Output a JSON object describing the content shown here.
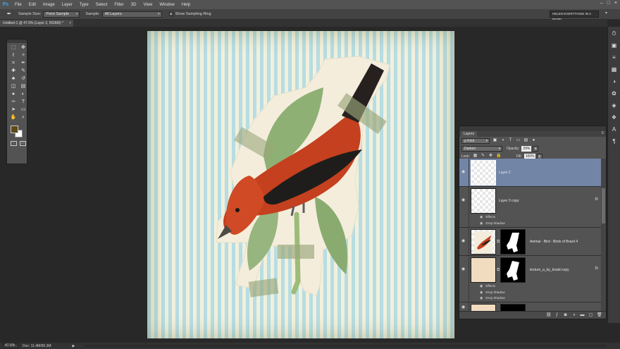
{
  "menubar": {
    "logo": "Ps",
    "items": [
      "File",
      "Edit",
      "Image",
      "Layer",
      "Type",
      "Select",
      "Filter",
      "3D",
      "View",
      "Window",
      "Help"
    ],
    "window_controls": [
      "–",
      "□",
      "×"
    ]
  },
  "options": {
    "sample_size_label": "Sample Size:",
    "sample_size_value": "Point Sample",
    "sample_label": "Sample:",
    "sample_value": "All Layers",
    "show_ring_label": "Show Sampling Ring",
    "workspace": "HELEN EVERYTHING IN A PANEL"
  },
  "document": {
    "tab_title": "Untitled-1 @ 47.6% (Layer 2, RGB/8) *",
    "close": "×"
  },
  "colors": {
    "foreground": "#5e4a15",
    "background": "#ffffff",
    "selected_layer": "#7285a6",
    "stripe_blue": "#b6dde3",
    "stripe_cream": "#f2f0dc"
  },
  "layers_panel": {
    "tab": "Layers",
    "filter_kind": "ρ Kind",
    "blend_mode": "Darken",
    "opacity_label": "Opacity:",
    "opacity_value": "29%",
    "lock_label": "Lock:",
    "fill_label": "Fill:",
    "fill_value": "100%",
    "layers": [
      {
        "name": "Layer 2",
        "selected": true,
        "effects": []
      },
      {
        "name": "Layer 3 copy",
        "selected": false,
        "fx": "fx",
        "effects_label": "Effects",
        "effects": [
          "Drop Shadow"
        ]
      },
      {
        "name": "Animal - Bird - Birds of Brazil 4",
        "selected": false,
        "effects": []
      },
      {
        "name": "texture_a_by_knald copy",
        "selected": false,
        "fx": "fx",
        "effects_label": "Effects",
        "effects": [
          "Drop Shadow",
          "Drop Shadow"
        ]
      }
    ]
  },
  "status": {
    "zoom": "47.6%",
    "doc_info": "Doc: 11.4M/96.3M",
    "arrow": "▶"
  }
}
